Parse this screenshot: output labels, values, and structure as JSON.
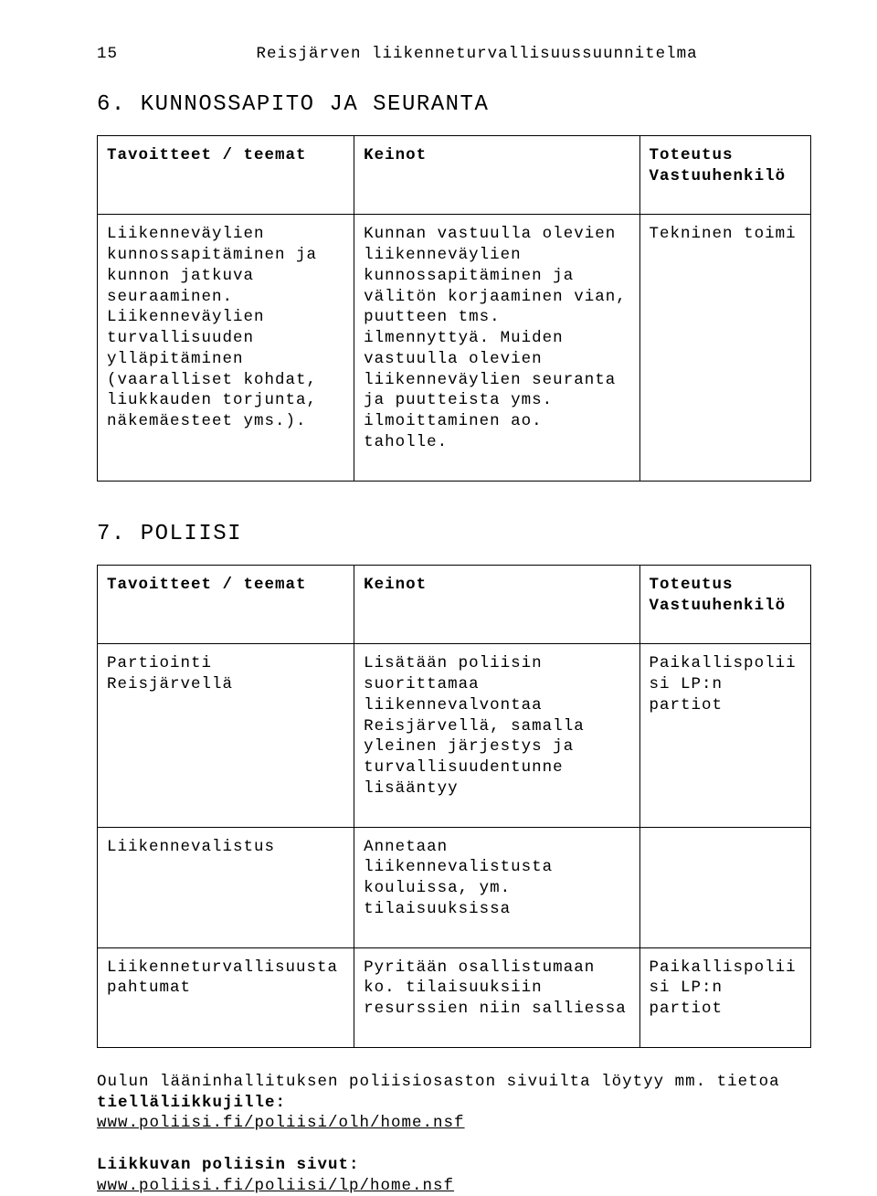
{
  "header": {
    "page_num": "15",
    "title": "Reisjärven liikenneturvallisuussuunnitelma"
  },
  "section6": {
    "heading": "6. KUNNOSSAPITO JA SEURANTA",
    "table": {
      "head": {
        "c1": "Tavoitteet / teemat",
        "c2": "Keinot",
        "c3": "Toteutus\nVastuuhenkilö"
      },
      "row1": {
        "c1": "Liikenneväylien kunnossapitäminen ja kunnon jatkuva seuraaminen. Liikenneväylien turvallisuuden ylläpitäminen (vaaralliset kohdat, liukkauden torjunta, näkemäesteet yms.).",
        "c2": "Kunnan vastuulla olevien liikenneväylien kunnossapitäminen ja välitön korjaaminen vian, puutteen tms. ilmennyttyä. Muiden vastuulla olevien liikenneväylien seuranta ja puutteista yms. ilmoittaminen ao. taholle.",
        "c3": "Tekninen toimi"
      }
    }
  },
  "section7": {
    "heading": "7. POLIISI",
    "table": {
      "head": {
        "c1": "Tavoitteet / teemat",
        "c2": "Keinot",
        "c3": "Toteutus\nVastuuhenkilö"
      },
      "row1": {
        "c1": "Partiointi Reisjärvellä",
        "c2": "Lisätään poliisin suorittamaa liikennevalvontaa Reisjärvellä, samalla yleinen järjestys ja turvallisuudentunne lisääntyy",
        "c3": "Paikallispoliisi LP:n partiot"
      },
      "row2": {
        "c1": "Liikennevalistus",
        "c2": "Annetaan liikennevalistusta kouluissa, ym. tilaisuuksissa",
        "c3": ""
      },
      "row3": {
        "c1": "Liikenneturvallisuusta pahtumat",
        "c2": "Pyritään osallistumaan ko. tilaisuuksiin resurssien niin salliessa",
        "c3": "Paikallispoliisi LP:n partiot"
      }
    }
  },
  "footer": {
    "line1a": "Oulun lääninhallituksen poliisiosaston sivuilta löytyy mm. tietoa",
    "line1b": "tielläliikkujille:",
    "link1": "www.poliisi.fi/poliisi/olh/home.nsf",
    "line2": "Liikkuvan poliisin sivut:",
    "link2": "www.poliisi.fi/poliisi/lp/home.nsf"
  }
}
